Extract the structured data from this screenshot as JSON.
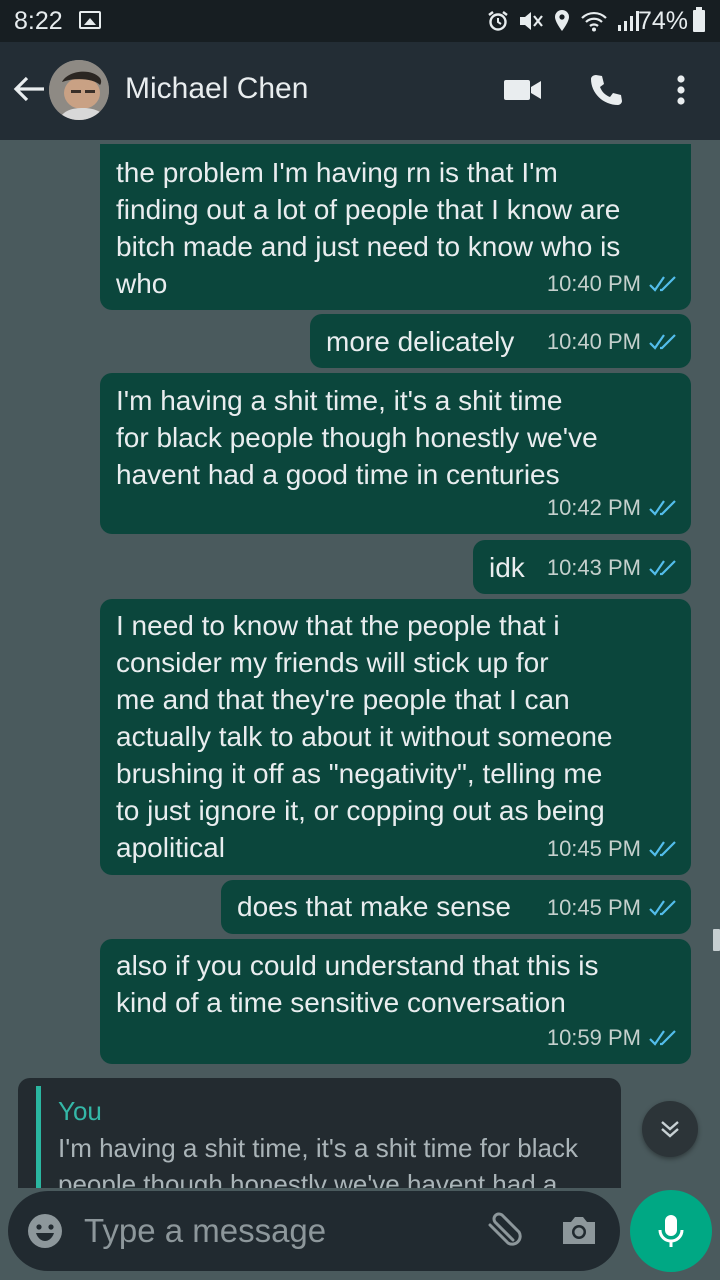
{
  "status_bar": {
    "time": "8:22",
    "battery": "74%"
  },
  "header": {
    "contact_name": "Michael Chen"
  },
  "messages": [
    {
      "text": "the problem I'm having rn is that I'm\nfinding out a lot of people that I know are\nbitch made and just need to know who is\nwho",
      "time": "10:40 PM"
    },
    {
      "text": "more delicately",
      "time": "10:40 PM"
    },
    {
      "text": "I'm having a shit time, it's a shit time\nfor black people though honestly we've\nhavent had a good time in centuries",
      "time": "10:42 PM"
    },
    {
      "text": "idk",
      "time": "10:43 PM"
    },
    {
      "text": "I need to know that the people that i\nconsider my friends will stick up for\nme and that they're people that I can\nactually talk to about it without someone\nbrushing it off as \"negativity\", telling me\nto just ignore it, or copping out as being\napolitical",
      "time": "10:45 PM"
    },
    {
      "text": "does that make sense",
      "time": "10:45 PM"
    },
    {
      "text": "also if you could understand that this is\nkind of a time sensitive conversation",
      "time": "10:59 PM"
    }
  ],
  "reply_preview": {
    "author": "You",
    "text": "I'm having a shit time, it's a shit time for black people though honestly we've havent had a good time in centuries"
  },
  "composer": {
    "placeholder": "Type a message"
  },
  "colors": {
    "outgoing_bubble": "#0b463c",
    "read_ticks": "#53bdeb",
    "accent": "#00a884"
  }
}
